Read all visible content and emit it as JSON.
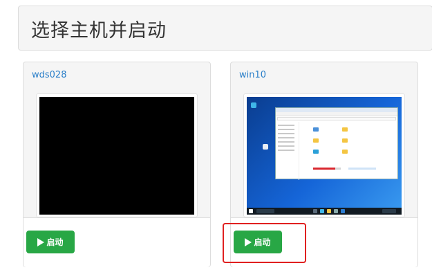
{
  "header": {
    "title": "选择主机并启动"
  },
  "hosts": [
    {
      "name": "wds028",
      "start_label": "启动"
    },
    {
      "name": "win10",
      "start_label": "启动"
    }
  ],
  "colors": {
    "start_button": "#28a745",
    "link": "#2a7fc9",
    "highlight": "#e02020"
  }
}
